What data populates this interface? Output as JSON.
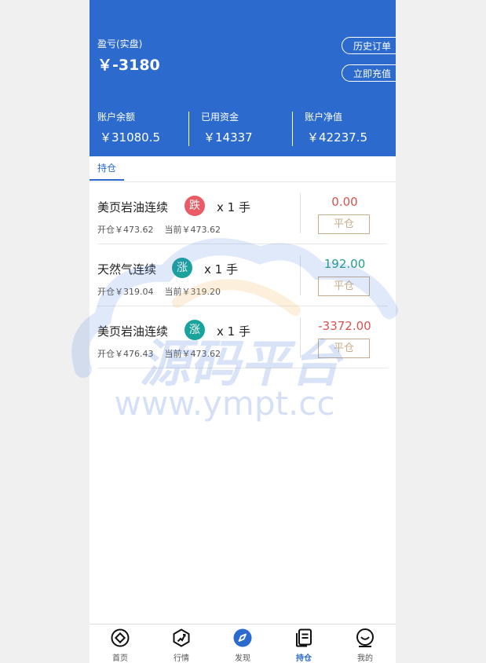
{
  "header": {
    "pnl_label": "盈亏(实盘)",
    "pnl_value": "￥-3180",
    "history_button": "历史订单",
    "recharge_button": "立即充值",
    "stats": [
      {
        "label": "账户余额",
        "value": "￥31080.5"
      },
      {
        "label": "已用资金",
        "value": "￥14337"
      },
      {
        "label": "账户净值",
        "value": "￥42237.5"
      }
    ]
  },
  "tabs": {
    "active": "持仓"
  },
  "positions": [
    {
      "name": "美页岩油连续",
      "direction": "跌",
      "quantity": "x 1 手",
      "open": "开仓￥473.62",
      "current": "当前￥473.62",
      "pnl": "0.00",
      "pnl_color": "#d9534f",
      "close_label": "平仓"
    },
    {
      "name": "天然气连续",
      "direction": "涨",
      "quantity": "x 1 手",
      "open": "开仓￥319.04",
      "current": "当前￥319.20",
      "pnl": "192.00",
      "pnl_color": "#22a08c",
      "close_label": "平仓"
    },
    {
      "name": "美页岩油连续",
      "direction": "涨",
      "quantity": "x 1 手",
      "open": "开仓￥476.43",
      "current": "当前￥473.62",
      "pnl": "-3372.00",
      "pnl_color": "#d9534f",
      "close_label": "平仓"
    }
  ],
  "watermark": {
    "brand": "源码平台",
    "url": "www.ympt.cc"
  },
  "nav": [
    {
      "label": "首页",
      "icon": "home-icon"
    },
    {
      "label": "行情",
      "icon": "market-icon"
    },
    {
      "label": "发现",
      "icon": "discover-icon"
    },
    {
      "label": "持仓",
      "icon": "position-icon",
      "active": true
    },
    {
      "label": "我的",
      "icon": "profile-icon"
    }
  ],
  "colors": {
    "primary": "#2c6bcd",
    "down": "#e95c66",
    "up": "#1aa39a"
  }
}
